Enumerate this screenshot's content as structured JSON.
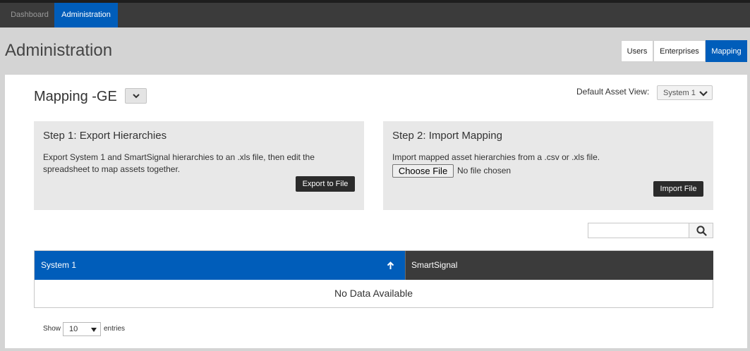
{
  "topnav": {
    "tabs": [
      {
        "label": "Dashboard",
        "active": false
      },
      {
        "label": "Administration",
        "active": true
      }
    ]
  },
  "page_title": "Administration",
  "segments": [
    {
      "label": "Users",
      "active": false
    },
    {
      "label": "Enterprises",
      "active": false
    },
    {
      "label": "Mapping",
      "active": true
    }
  ],
  "mapping": {
    "title": "Mapping -GE",
    "dropdown_icon": "chevron-down-icon",
    "default_asset_view_label": "Default Asset View:",
    "default_asset_view_value": "System 1"
  },
  "step1": {
    "title": "Step 1: Export Hierarchies",
    "description": "Export System 1 and SmartSignal hierarchies to an .xls file, then edit the spreadsheet to map assets together.",
    "button_label": "Export to File"
  },
  "step2": {
    "title": "Step 2: Import Mapping",
    "description": "Import mapped asset hierarchies from a .csv or .xls file.",
    "choose_file_label": "Choose File",
    "no_file_text": "No file chosen",
    "button_label": "Import File"
  },
  "search": {
    "placeholder": "",
    "icon": "search-icon"
  },
  "table": {
    "columns": [
      {
        "label": "System 1",
        "sorted": "ascending",
        "sort_icon": "arrow-up-icon"
      },
      {
        "label": "SmartSignal",
        "sorted": null
      }
    ],
    "empty_text": "No Data Available"
  },
  "pagination": {
    "show_label": "Show",
    "page_length": "10",
    "entries_label": "entries"
  },
  "colors": {
    "primary_blue": "#005dba",
    "dark_bar": "#3b3b3b",
    "background": "#d4d4d4"
  }
}
